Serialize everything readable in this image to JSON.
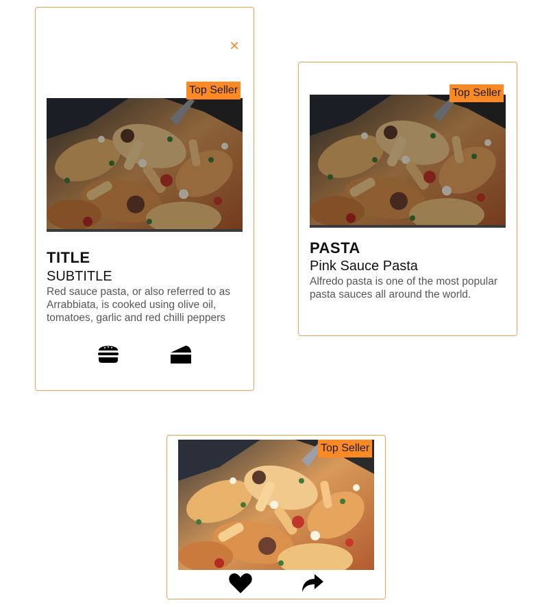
{
  "cards": [
    {
      "close_icon": "close-icon",
      "badge": "Top Seller",
      "title": "TITLE",
      "subtitle": "SUBTITLE",
      "description": "Red sauce pasta, or also referred to as Arrabbiata, is cooked using olive oil, tomatoes, garlic and red chilli peppers",
      "icons": [
        "burger-icon",
        "cake-slice-icon"
      ]
    },
    {
      "badge": "Top Seller",
      "title": "PASTA",
      "subtitle": "Pink Sauce Pasta",
      "description": "Alfredo pasta is one of the most popular pasta sauces all around the world."
    },
    {
      "badge": "Top Seller",
      "icons": [
        "heart-icon",
        "share-icon"
      ]
    }
  ],
  "colors": {
    "accent": "#fb8a24",
    "card_border": "#f0a050",
    "close": "#f28a2e",
    "text": "#111111",
    "description": "#555555"
  }
}
